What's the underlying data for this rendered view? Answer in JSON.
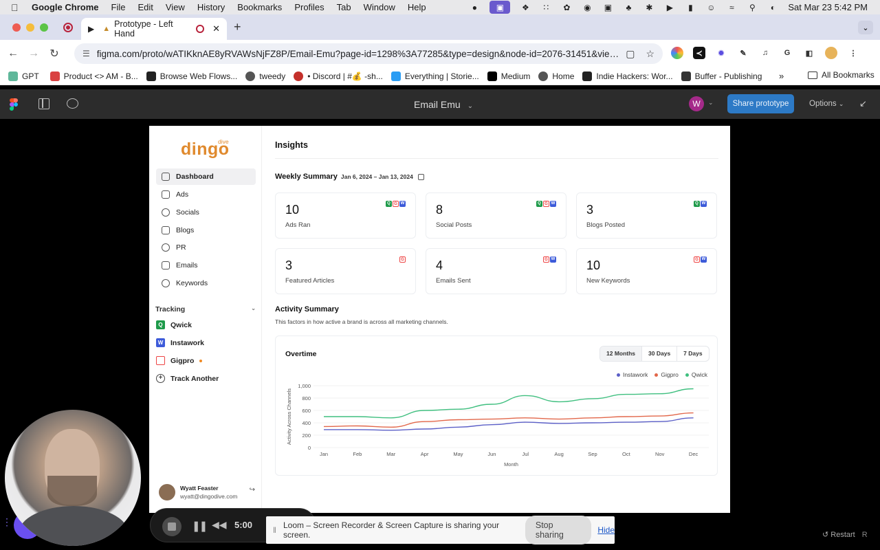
{
  "menubar": {
    "app": "Google Chrome",
    "items": [
      "File",
      "Edit",
      "View",
      "History",
      "Bookmarks",
      "Profiles",
      "Tab",
      "Window",
      "Help"
    ],
    "datetime": "Sat Mar 23  5:42 PM"
  },
  "tab": {
    "title": "Prototype - Left Hand"
  },
  "toolbar": {
    "url": "figma.com/proto/wATIKknAE8yRVAWsNjFZ8P/Email-Emu?page-id=1298%3A77285&type=design&node-id=2076-31451&viewp..."
  },
  "bookmarks": {
    "items": [
      "GPT",
      "Product <> AM - B...",
      "Browse Web Flows...",
      "tweedy",
      "• Discord | #💰 -sh...",
      "Everything | Storie...",
      "Medium",
      "Home",
      "Indie Hackers: Wor...",
      "Buffer - Publishing"
    ],
    "more": "»",
    "all": "All Bookmarks"
  },
  "figma": {
    "file_title": "Email Emu",
    "avatar_initial": "W",
    "share_label": "Share prototype",
    "options_label": "Options"
  },
  "app": {
    "logo": "dingo",
    "logo_sub": "dive",
    "nav": [
      "Dashboard",
      "Ads",
      "Socials",
      "Blogs",
      "PR",
      "Emails",
      "Keywords"
    ],
    "tracking_title": "Tracking",
    "tracking": [
      "Qwick",
      "Instawork",
      "Gigpro",
      "Track Another"
    ],
    "user": {
      "name": "Wyatt Feaster",
      "email": "wyatt@dingodive.com"
    }
  },
  "insights": {
    "title": "Insights",
    "weekly_title": "Weekly Summary",
    "weekly_range": "Jan 6, 2024 – Jan 13, 2024",
    "cards": [
      {
        "value": "10",
        "label": "Ads Ran"
      },
      {
        "value": "8",
        "label": "Social Posts"
      },
      {
        "value": "3",
        "label": "Blogs Posted"
      },
      {
        "value": "3",
        "label": "Featured Articles"
      },
      {
        "value": "4",
        "label": "Emails Sent"
      },
      {
        "value": "10",
        "label": "New Keywords"
      }
    ],
    "activity_title": "Activity Summary",
    "activity_sub": "This factors in how active a brand is across all marketing channels.",
    "overtime_title": "Overtime",
    "ranges": [
      "12 Months",
      "30 Days",
      "7 Days"
    ]
  },
  "chart_data": {
    "type": "line",
    "title": "Overtime",
    "xlabel": "Month",
    "ylabel": "Activity Across Channels",
    "categories": [
      "Jan",
      "Feb",
      "Mar",
      "Apr",
      "May",
      "Jun",
      "Jul",
      "Aug",
      "Sep",
      "Oct",
      "Nov",
      "Dec"
    ],
    "yticks": [
      "0",
      "200",
      "400",
      "600",
      "800",
      "1,000"
    ],
    "ylim": [
      0,
      1000
    ],
    "legend_position": "top-right",
    "series": [
      {
        "name": "Instawork",
        "color": "#5b5fc7",
        "values": [
          290,
          290,
          280,
          300,
          330,
          370,
          410,
          390,
          400,
          410,
          420,
          480
        ]
      },
      {
        "name": "Gigpro",
        "color": "#e2674a",
        "values": [
          340,
          350,
          330,
          420,
          450,
          460,
          480,
          460,
          480,
          500,
          510,
          560
        ]
      },
      {
        "name": "Qwick",
        "color": "#3fbf7f",
        "values": [
          500,
          500,
          480,
          600,
          620,
          700,
          840,
          740,
          790,
          860,
          870,
          950
        ]
      }
    ]
  },
  "loom": {
    "message": "Loom – Screen Recorder & Screen Capture is sharing your screen.",
    "stop": "Stop sharing",
    "hide": "Hide",
    "timer": "5:00"
  },
  "restart": {
    "label": "Restart",
    "key": "R"
  }
}
